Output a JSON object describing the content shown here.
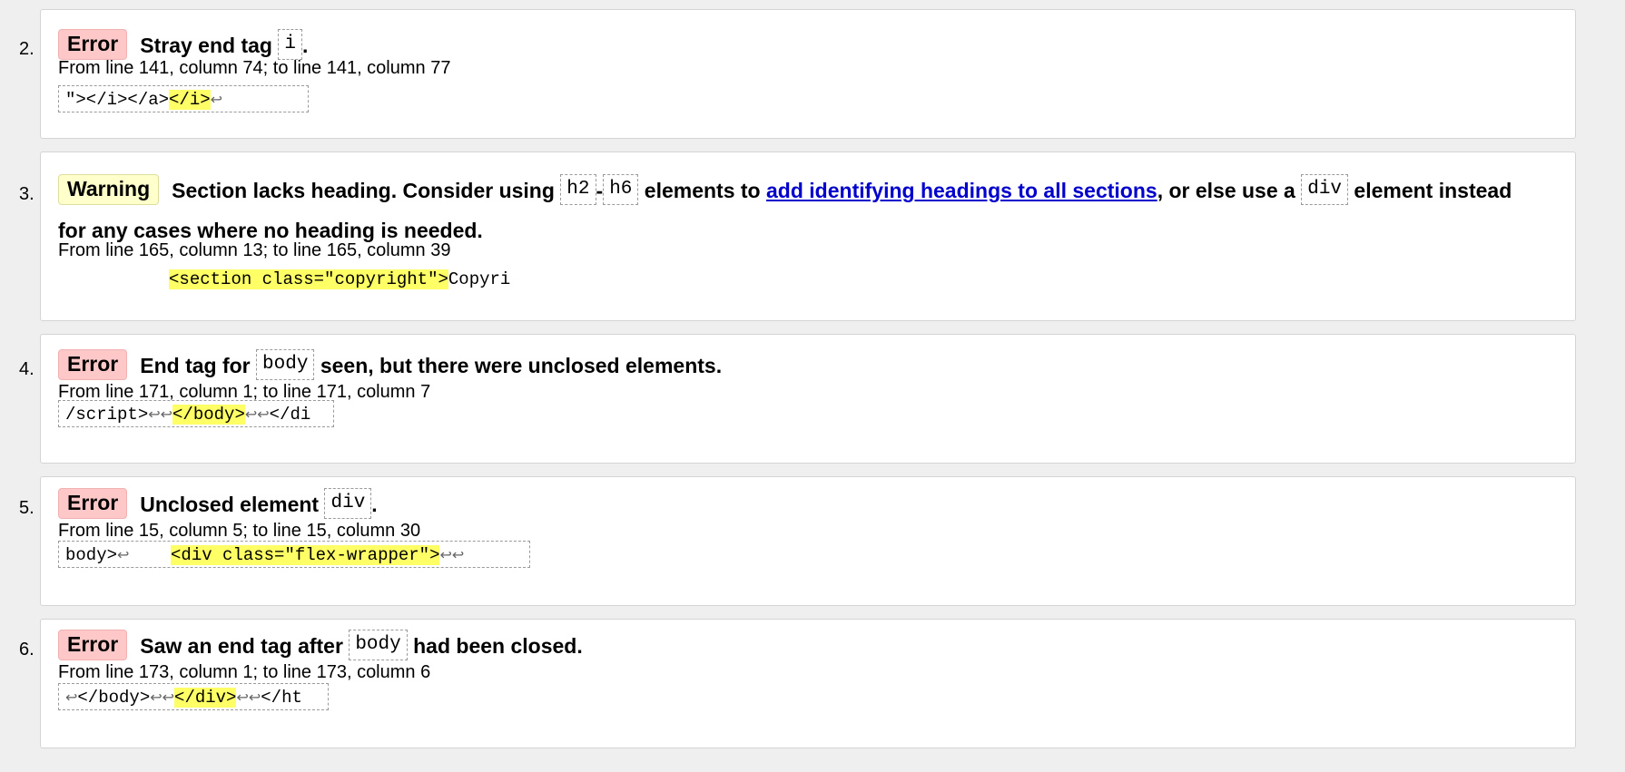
{
  "messages": [
    {
      "number": "2.",
      "type": "Error",
      "parts": [
        {
          "t": "text",
          "v": "Stray end tag "
        },
        {
          "t": "code",
          "v": "i"
        },
        {
          "t": "text",
          "v": "."
        }
      ],
      "location": "From line 141, column 74; to line 141, column 77",
      "extract": [
        {
          "t": "text",
          "v": "\"></i></a>"
        },
        {
          "t": "hl",
          "v": "</i>"
        },
        {
          "t": "lf",
          "v": "↩"
        }
      ]
    },
    {
      "number": "3.",
      "type": "Warning",
      "parts": [
        {
          "t": "text",
          "v": "Section lacks heading. Consider using "
        },
        {
          "t": "code",
          "v": "h2"
        },
        {
          "t": "text",
          "v": "-"
        },
        {
          "t": "code",
          "v": "h6"
        },
        {
          "t": "text",
          "v": " elements to "
        },
        {
          "t": "link",
          "v": "add identifying headings to all sections"
        },
        {
          "t": "text",
          "v": ", or else use a "
        },
        {
          "t": "code",
          "v": "div"
        },
        {
          "t": "text",
          "v": " element instead for any cases where no heading is needed."
        }
      ],
      "location": "From line 165, column 13; to line 165, column 39",
      "extract": [
        {
          "t": "text",
          "v": "          "
        },
        {
          "t": "hl",
          "v": "<section class=\"copyright\">"
        },
        {
          "t": "text",
          "v": "Copyri"
        }
      ]
    },
    {
      "number": "4.",
      "type": "Error",
      "parts": [
        {
          "t": "text",
          "v": "End tag for "
        },
        {
          "t": "code",
          "v": "body"
        },
        {
          "t": "text",
          "v": " seen, but there were unclosed elements."
        }
      ],
      "location": "From line 171, column 1; to line 171, column 7",
      "extract": [
        {
          "t": "text",
          "v": "/script>"
        },
        {
          "t": "lf",
          "v": "↩↩"
        },
        {
          "t": "hl",
          "v": "</body>"
        },
        {
          "t": "lf",
          "v": "↩↩"
        },
        {
          "t": "text",
          "v": "</di"
        }
      ]
    },
    {
      "number": "5.",
      "type": "Error",
      "parts": [
        {
          "t": "text",
          "v": "Unclosed element "
        },
        {
          "t": "code",
          "v": "div"
        },
        {
          "t": "text",
          "v": "."
        }
      ],
      "location": "From line 15, column 5; to line 15, column 30",
      "extract": [
        {
          "t": "text",
          "v": "body>"
        },
        {
          "t": "lf",
          "v": "↩"
        },
        {
          "t": "text",
          "v": "    "
        },
        {
          "t": "hl",
          "v": "<div class=\"flex-wrapper\">"
        },
        {
          "t": "lf",
          "v": "↩↩"
        }
      ]
    },
    {
      "number": "6.",
      "type": "Error",
      "parts": [
        {
          "t": "text",
          "v": "Saw an end tag after "
        },
        {
          "t": "code",
          "v": "body"
        },
        {
          "t": "text",
          "v": " had been closed."
        }
      ],
      "location": "From line 173, column 1; to line 173, column 6",
      "extract": [
        {
          "t": "lf",
          "v": "↩"
        },
        {
          "t": "text",
          "v": "</body>"
        },
        {
          "t": "lf",
          "v": "↩↩"
        },
        {
          "t": "hl",
          "v": "</div>"
        },
        {
          "t": "lf",
          "v": "↩↩"
        },
        {
          "t": "text",
          "v": "</ht"
        }
      ]
    }
  ],
  "colors": {
    "error_badge": "#ffc8c8",
    "warning_badge": "#ffffcc",
    "highlight": "#ffff66",
    "link": "#0000cc",
    "page_background": "#efefef"
  }
}
